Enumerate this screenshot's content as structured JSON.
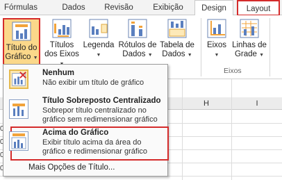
{
  "tabs": [
    {
      "label": "Fórmulas"
    },
    {
      "label": "Dados"
    },
    {
      "label": "Revisão"
    },
    {
      "label": "Exibição"
    },
    {
      "label": "Design"
    },
    {
      "label": "Layout"
    }
  ],
  "ribbon": {
    "chart_title": {
      "line1": "Título do",
      "line2": "Gráfico"
    },
    "axis_titles": {
      "line1": "Títulos",
      "line2": "dos Eixos"
    },
    "legend": {
      "line1": "Legenda"
    },
    "data_labels": {
      "line1": "Rótulos de",
      "line2": "Dados"
    },
    "data_table": {
      "line1": "Tabela de",
      "line2": "Dados"
    },
    "axes": {
      "line1": "Eixos"
    },
    "gridlines": {
      "line1": "Linhas de",
      "line2": "Grade"
    },
    "group_axes_label": "Eixos",
    "accent_color": "#d42b2b",
    "highlight_color": "#fbd88a"
  },
  "sheet": {
    "column_h": "H",
    "column_i": "I",
    "row_digits": [
      "0",
      "0",
      "0",
      "0"
    ]
  },
  "menu": {
    "items": [
      {
        "title": "Nenhum",
        "description": "Não exibir um título de gráfico",
        "icon": "chart-no-title-icon"
      },
      {
        "title": "Título Sobreposto Centralizado",
        "description": "Sobrepor título centralizado no gráfico sem redimensionar gráfico",
        "icon": "chart-overlay-title-icon"
      },
      {
        "title": "Acima do Gráfico",
        "description": "Exibir título acima da área do gráfico e redimensionar gráfico",
        "icon": "chart-title-above-icon"
      }
    ],
    "more_options": "Mais Opções de Título..."
  }
}
